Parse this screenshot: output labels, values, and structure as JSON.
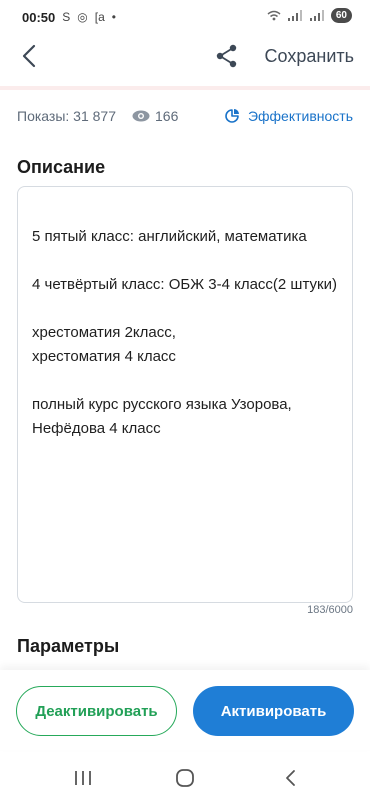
{
  "status_bar": {
    "time": "00:50",
    "notification_icons": [
      "S",
      "◎",
      "[a",
      "•"
    ],
    "battery": "60"
  },
  "app_bar": {
    "save_label": "Сохранить"
  },
  "stats": {
    "impressions": "Показы: 31 877",
    "views": "166",
    "efficiency_label": "Эффективность"
  },
  "description": {
    "title": "Описание",
    "text": "5 пятый класс: английский, математика\n\n4 четвёртый класс: ОБЖ 3-4 класс(2 штуки)\n\nхрестоматия 2класс,\nхрестоматия 4 класс\n\nполный курс русского языка Узорова, Нефёдова 4 класс",
    "counter": "183/6000"
  },
  "parameters": {
    "title": "Параметры"
  },
  "actions": {
    "deactivate_label": "Деактивировать",
    "activate_label": "Активировать"
  },
  "colors": {
    "accent_blue": "#1f7ed6",
    "accent_green": "#26a95a"
  },
  "icons": [
    "back-arrow-icon",
    "share-icon",
    "eye-icon",
    "pie-chart-icon"
  ]
}
